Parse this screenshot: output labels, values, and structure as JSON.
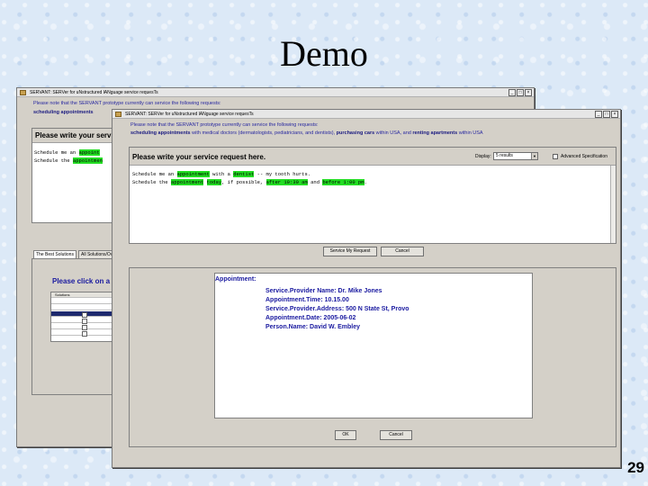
{
  "slide": {
    "title": "Demo",
    "page_number": "29"
  },
  "back_window": {
    "title": "SERVANT: SERVer for uNstructured lANguage service requesTs",
    "note_line1": "Please note that the SERVANT prototype currently can service the following requests:",
    "note_line2_bold": "scheduling appointments",
    "heading": "Please write your service r",
    "request_lines": [
      {
        "pre": "Schedule me an ",
        "hl": "appoint"
      },
      {
        "pre": "Schedule the ",
        "hl": "appointmen"
      }
    ],
    "tabs": [
      "The Best Solutions",
      "All Solutions/Ov"
    ],
    "list_heading": "Please click on a d",
    "list_column": "Solutions"
  },
  "front_window": {
    "title": "SERVANT: SERVer for uNstructured lANguage service requesTs",
    "note_line1": "Please note that the SERVANT prototype currently can service the following requests:",
    "note_line2": [
      {
        "text": "scheduling appointments",
        "bold": true
      },
      {
        "text": " with medical doctors (dermatologists, pediatricians, and dentists), ",
        "bold": false
      },
      {
        "text": "purchasing cars",
        "bold": true
      },
      {
        "text": " within USA, and ",
        "bold": false
      },
      {
        "text": "renting apartments",
        "bold": true
      },
      {
        "text": " within USA",
        "bold": false
      }
    ],
    "heading": "Please write your service request here.",
    "display_label": "Display:",
    "display_value": "5 results",
    "advanced_label": "Advanced Specification",
    "request_line1": [
      {
        "text": "Schedule me an ",
        "hl": false
      },
      {
        "text": "appointment",
        "hl": true
      },
      {
        "text": " with a ",
        "hl": false
      },
      {
        "text": "dentist",
        "hl": true
      },
      {
        "text": " -- my tooth hurts.",
        "hl": false
      }
    ],
    "request_line2": [
      {
        "text": "Schedule the ",
        "hl": false
      },
      {
        "text": "appointment",
        "hl": true
      },
      {
        "text": " ",
        "hl": false
      },
      {
        "text": "today",
        "hl": true
      },
      {
        "text": ", if possible, ",
        "hl": false
      },
      {
        "text": "after 10:30 am",
        "hl": true
      },
      {
        "text": " and ",
        "hl": false
      },
      {
        "text": "before 1:00 pm",
        "hl": true
      },
      {
        "text": ".",
        "hl": false
      }
    ],
    "service_button": "Service My Request",
    "cancel_button": "Cancel",
    "result": {
      "label": "Appointment:",
      "fields": [
        "Service.Provider Name: Dr. Mike Jones",
        "Appointment.Time: 10.15.00",
        "Service.Provider.Address: 500 N State St, Provo",
        "Appointment.Date: 2005-06-02",
        "Person.Name: David W. Embley"
      ]
    },
    "ok_button": "OK",
    "cancel_button2": "Cancel"
  }
}
